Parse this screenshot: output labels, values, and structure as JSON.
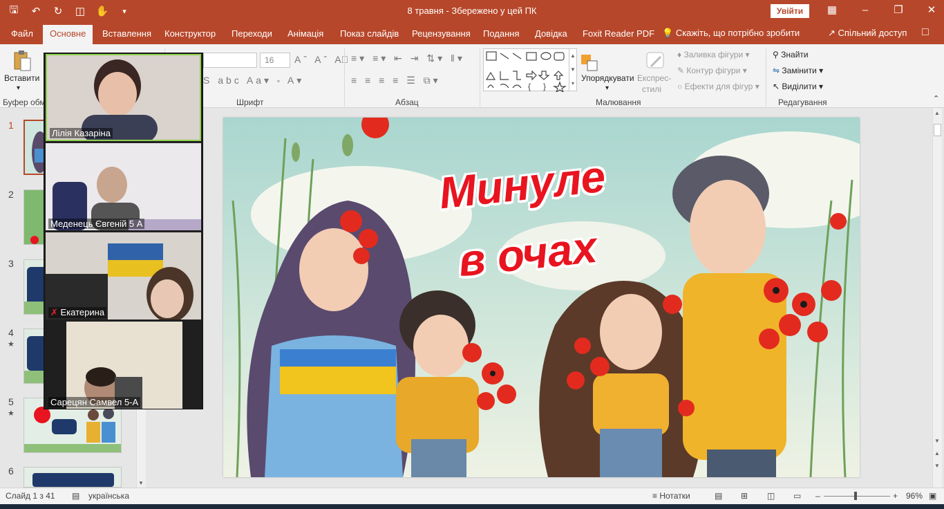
{
  "window": {
    "title": "8 травня  -  Збережено у цей ПК",
    "signin_label": "Увійти"
  },
  "tabs": [
    {
      "label": "Файл"
    },
    {
      "label": "Основне"
    },
    {
      "label": "Вставлення"
    },
    {
      "label": "Конструктор"
    },
    {
      "label": "Переходи"
    },
    {
      "label": "Анімація"
    },
    {
      "label": "Показ слайдів"
    },
    {
      "label": "Рецензування"
    },
    {
      "label": "Подання"
    },
    {
      "label": "Довідка"
    },
    {
      "label": "Foxit Reader PDF"
    }
  ],
  "tell_me": "Скажіть, що потрібно зробити",
  "share": "Спільний доступ",
  "ribbon": {
    "paste_label": "Вставити",
    "clipboard_label": "Буфер обм",
    "font_size": "16",
    "font_group": "Шрифт",
    "paragraph_group": "Абзац",
    "arrange_label": "Упорядкувати",
    "quick_styles_line1": "Експрес-",
    "quick_styles_line2": "стилі",
    "shape_fill": "Заливка фігури",
    "shape_outline": "Контур фігури",
    "shape_effects": "Ефекти для фігур",
    "drawing_group": "Малювання",
    "find": "Знайти",
    "replace": "Замінити",
    "select": "Виділити",
    "editing_group": "Редагування"
  },
  "thumbnails": [
    {
      "num": "1",
      "star": ""
    },
    {
      "num": "2",
      "star": ""
    },
    {
      "num": "3",
      "star": ""
    },
    {
      "num": "4",
      "star": "★"
    },
    {
      "num": "5",
      "star": "★"
    },
    {
      "num": "6",
      "star": ""
    }
  ],
  "slide": {
    "title_line1": "Минуле",
    "title_line2": "в  очах"
  },
  "participants": [
    {
      "name": "Лілія Казаріна"
    },
    {
      "name": "Меденець Євгеній 5 А"
    },
    {
      "name": "Екатерина"
    },
    {
      "name": "Сарецян Самвел 5-А"
    }
  ],
  "status": {
    "slide_counter": "Слайд 1 з 41",
    "language": "українська",
    "notes": "Нотатки",
    "zoom": "96%"
  },
  "colors": {
    "accent": "#b7472a",
    "title_red": "#e8141f"
  }
}
